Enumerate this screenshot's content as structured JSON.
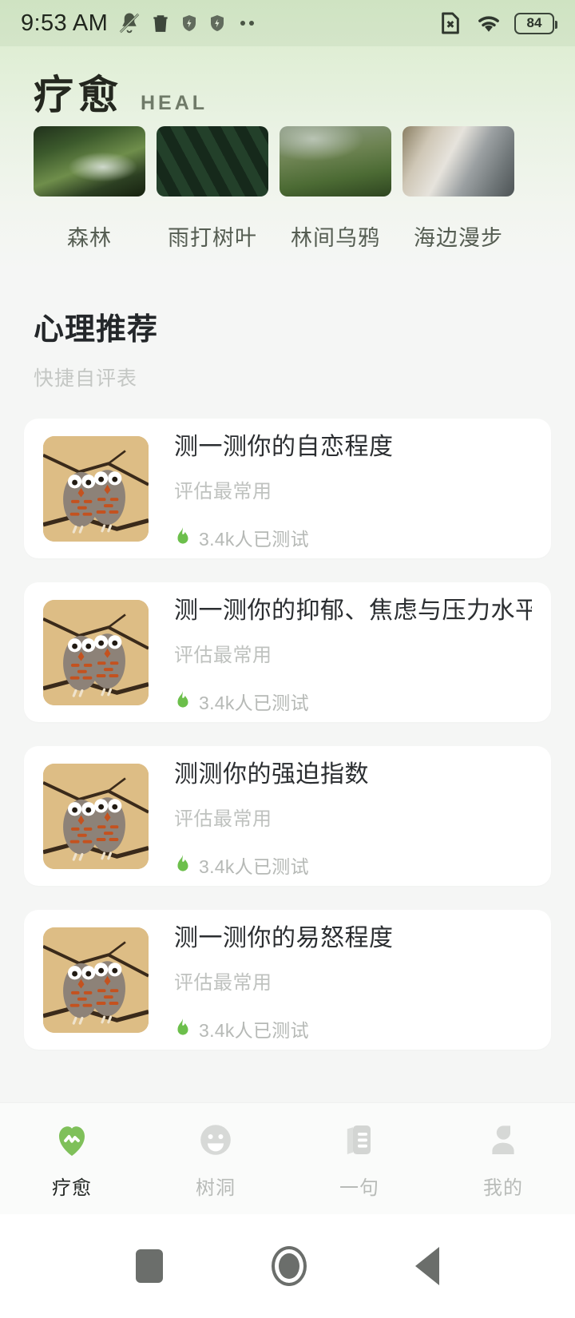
{
  "status_bar": {
    "time": "9:53 AM",
    "battery_percent": "84",
    "left_icons": [
      "mute-bell-icon",
      "trash-icon",
      "shield-bolt-icon",
      "shield-bolt-icon",
      "overflow-dots-icon"
    ],
    "right_icons": [
      "no-sim-icon",
      "wifi-icon",
      "battery-icon"
    ]
  },
  "header": {
    "brand_cn": "疗愈",
    "brand_en": "HEAL"
  },
  "carousel": {
    "items": [
      {
        "label": "森林",
        "thumb": "forest-river-thumb"
      },
      {
        "label": "雨打树叶",
        "thumb": "rain-leaves-thumb"
      },
      {
        "label": "林间乌鸦",
        "thumb": "misty-hills-thumb"
      },
      {
        "label": "海边漫步",
        "thumb": "seaside-thumb"
      }
    ]
  },
  "section": {
    "title": "心理推荐",
    "subtitle": "快捷自评表"
  },
  "cards": [
    {
      "title": "测一测你的自恋程度",
      "subtitle": "评估最常用",
      "count": "3.4k人已测试",
      "thumb": "two-owls-thumb"
    },
    {
      "title": "测一测你的抑郁、焦虑与压力水平",
      "subtitle": "评估最常用",
      "count": "3.4k人已测试",
      "thumb": "two-owls-thumb"
    },
    {
      "title": "测测你的强迫指数",
      "subtitle": "评估最常用",
      "count": "3.4k人已测试",
      "thumb": "two-owls-thumb"
    },
    {
      "title": "测一测你的易怒程度",
      "subtitle": "评估最常用",
      "count": "3.4k人已测试",
      "thumb": "two-owls-thumb"
    }
  ],
  "tabbar": {
    "tabs": [
      {
        "label": "疗愈",
        "icon": "heart-pulse-icon",
        "active": true
      },
      {
        "label": "树洞",
        "icon": "smiley-face-icon",
        "active": false
      },
      {
        "label": "一句",
        "icon": "document-icon",
        "active": false
      },
      {
        "label": "我的",
        "icon": "person-icon",
        "active": false
      }
    ]
  },
  "system_nav": {
    "buttons": [
      "recents-square-icon",
      "home-circle-icon",
      "back-triangle-icon"
    ]
  },
  "colors": {
    "accent_green": "#8ec862",
    "header_gradient_top": "#cfe3c2",
    "page_background": "#f5f6f5",
    "card_background": "#ffffff",
    "muted_text": "#bfc2bf"
  }
}
